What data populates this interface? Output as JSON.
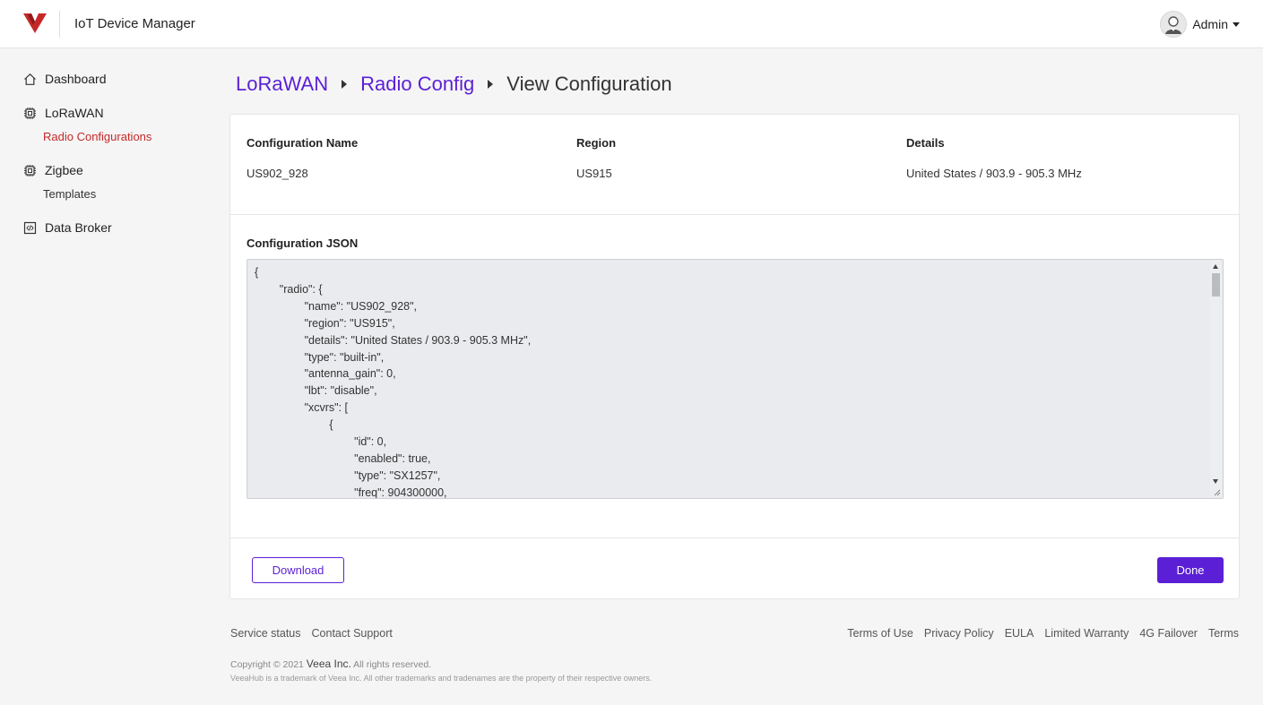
{
  "header": {
    "app_title": "IoT Device Manager",
    "user_name": "Admin",
    "brand_color": "#c62828"
  },
  "sidebar": {
    "items": [
      {
        "label": "Dashboard",
        "icon": "home-icon"
      },
      {
        "label": "LoRaWAN",
        "icon": "chip-icon",
        "children": [
          "Radio Configurations"
        ]
      },
      {
        "label": "Zigbee",
        "icon": "chip-icon",
        "children": [
          "Templates"
        ]
      },
      {
        "label": "Data Broker",
        "icon": "code-icon"
      }
    ],
    "active_child": "Radio Configurations"
  },
  "breadcrumb": {
    "items": [
      "LoRaWAN",
      "Radio Config"
    ],
    "current": "View Configuration"
  },
  "config": {
    "name_label": "Configuration Name",
    "name_value": "US902_928",
    "region_label": "Region",
    "region_value": "US915",
    "details_label": "Details",
    "details_value": "United States / 903.9 - 905.3 MHz",
    "json_label": "Configuration JSON",
    "json_text": "{\n        \"radio\": {\n                \"name\": \"US902_928\",\n                \"region\": \"US915\",\n                \"details\": \"United States / 903.9 - 905.3 MHz\",\n                \"type\": \"built-in\",\n                \"antenna_gain\": 0,\n                \"lbt\": \"disable\",\n                \"xcvrs\": [\n                        {\n                                \"id\": 0,\n                                \"enabled\": true,\n                                \"type\": \"SX1257\",\n                                \"freq\": 904300000,"
  },
  "actions": {
    "download_label": "Download",
    "done_label": "Done"
  },
  "footer": {
    "left_links": [
      "Service status",
      "Contact Support"
    ],
    "right_links": [
      "Terms of Use",
      "Privacy Policy",
      "EULA",
      "Limited Warranty",
      "4G Failover",
      "Terms"
    ],
    "copyright_prefix": "Copyright © 2021 ",
    "copyright_brand": "Veea Inc.",
    "copyright_suffix": " All rights reserved.",
    "trademark": "VeeaHub is a trademark of Veea Inc. All other trademarks and tradenames are the property of their respective owners."
  },
  "colors": {
    "accent": "#5b1fd6",
    "active_nav": "#c62828"
  }
}
